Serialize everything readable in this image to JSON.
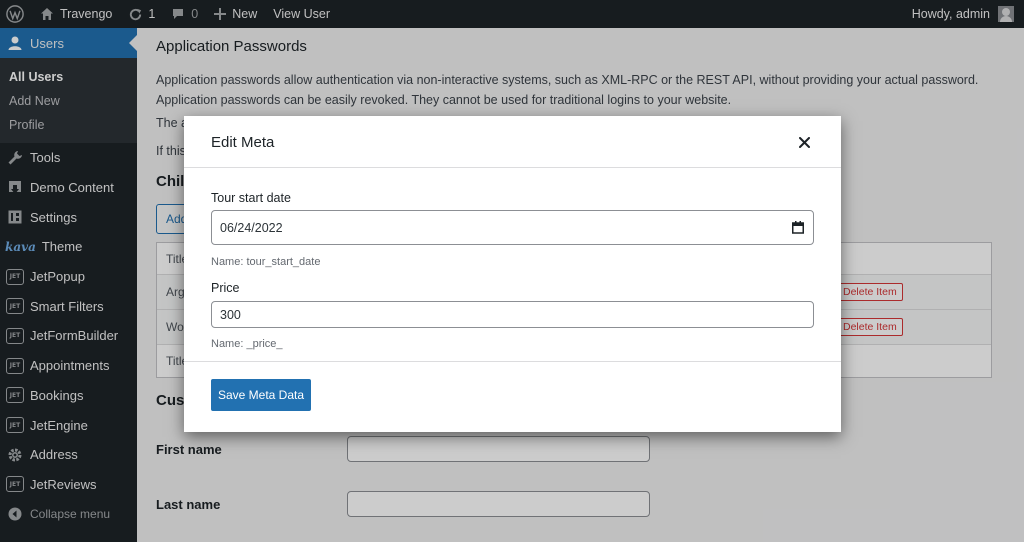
{
  "adminbar": {
    "site_name": "Travengo",
    "updates_count": "1",
    "comments_count": "0",
    "new_label": "New",
    "view_user_label": "View User",
    "howdy": "Howdy, admin"
  },
  "sidebar": {
    "users_label": "Users",
    "submenu": [
      "All Users",
      "Add New",
      "Profile"
    ],
    "items": [
      "Tools",
      "Demo Content",
      "Settings",
      "Theme",
      "JetPopup",
      "Smart Filters",
      "JetFormBuilder",
      "Appointments",
      "Bookings",
      "JetEngine",
      "Address",
      "JetReviews"
    ],
    "kava_logo": "kava",
    "jet_badge": "JET",
    "collapse_label": "Collapse menu"
  },
  "page": {
    "app_passwords_title": "Application Passwords",
    "app_passwords_desc": "Application passwords allow authentication via non-interactive systems, such as XML-RPC or the REST API, without providing your actual password. Application passwords can be easily revoked. They cannot be used for traditional logins to your website.",
    "frag_the": "The a",
    "frag_if": "If this",
    "child_heading": "Chil",
    "add_fragment": "Add",
    "row_labels": [
      "Title",
      "Arg",
      "Wor",
      "Title"
    ],
    "delete_item_label": "Delete Item",
    "custom_heading": "Cust",
    "first_name_label": "First name",
    "last_name_label": "Last name"
  },
  "modal": {
    "title": "Edit Meta",
    "fields": [
      {
        "label": "Tour start date",
        "value": "06/24/2022",
        "hint": "Name: tour_start_date"
      },
      {
        "label": "Price",
        "value": "300",
        "hint": "Name: _price_"
      }
    ],
    "save_label": "Save Meta Data"
  },
  "colors": {
    "accent": "#2271b1",
    "adminbar": "#1d2327",
    "danger": "#d63638"
  }
}
